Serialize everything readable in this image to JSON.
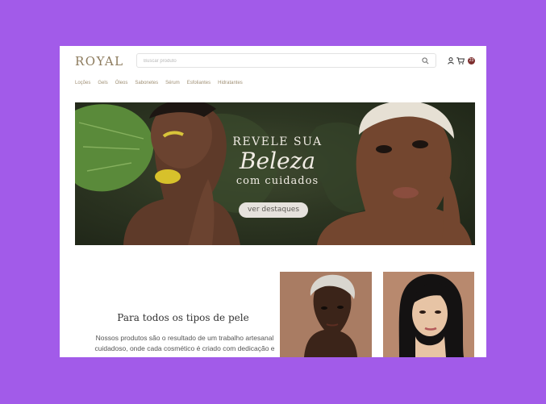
{
  "header": {
    "logo": "ROYAL",
    "search_placeholder": "Buscar produto",
    "icons": [
      "search-icon",
      "user-icon",
      "cart-icon"
    ],
    "cart_count": "23"
  },
  "nav": {
    "items": [
      "Loções",
      "Gels",
      "Óleos",
      "Sabonetes",
      "Sérum",
      "Esfoliantes",
      "Hidratantes"
    ]
  },
  "hero": {
    "line1": "REVELE SUA",
    "line2": "Beleza",
    "line3": "com cuidados",
    "button": "ver destaques"
  },
  "section": {
    "title": "Para todos os tipos de pele",
    "body_line1": "Nossos produtos são o resultado de um trabalho artesanal",
    "body_line2": "cuidadoso, onde cada cosmético é criado com dedicação e"
  },
  "colors": {
    "page_background": "#a25be9",
    "brand": "#8c7a5c",
    "cart_badge": "#7d2e2e",
    "hero_background": "#2d3622"
  }
}
